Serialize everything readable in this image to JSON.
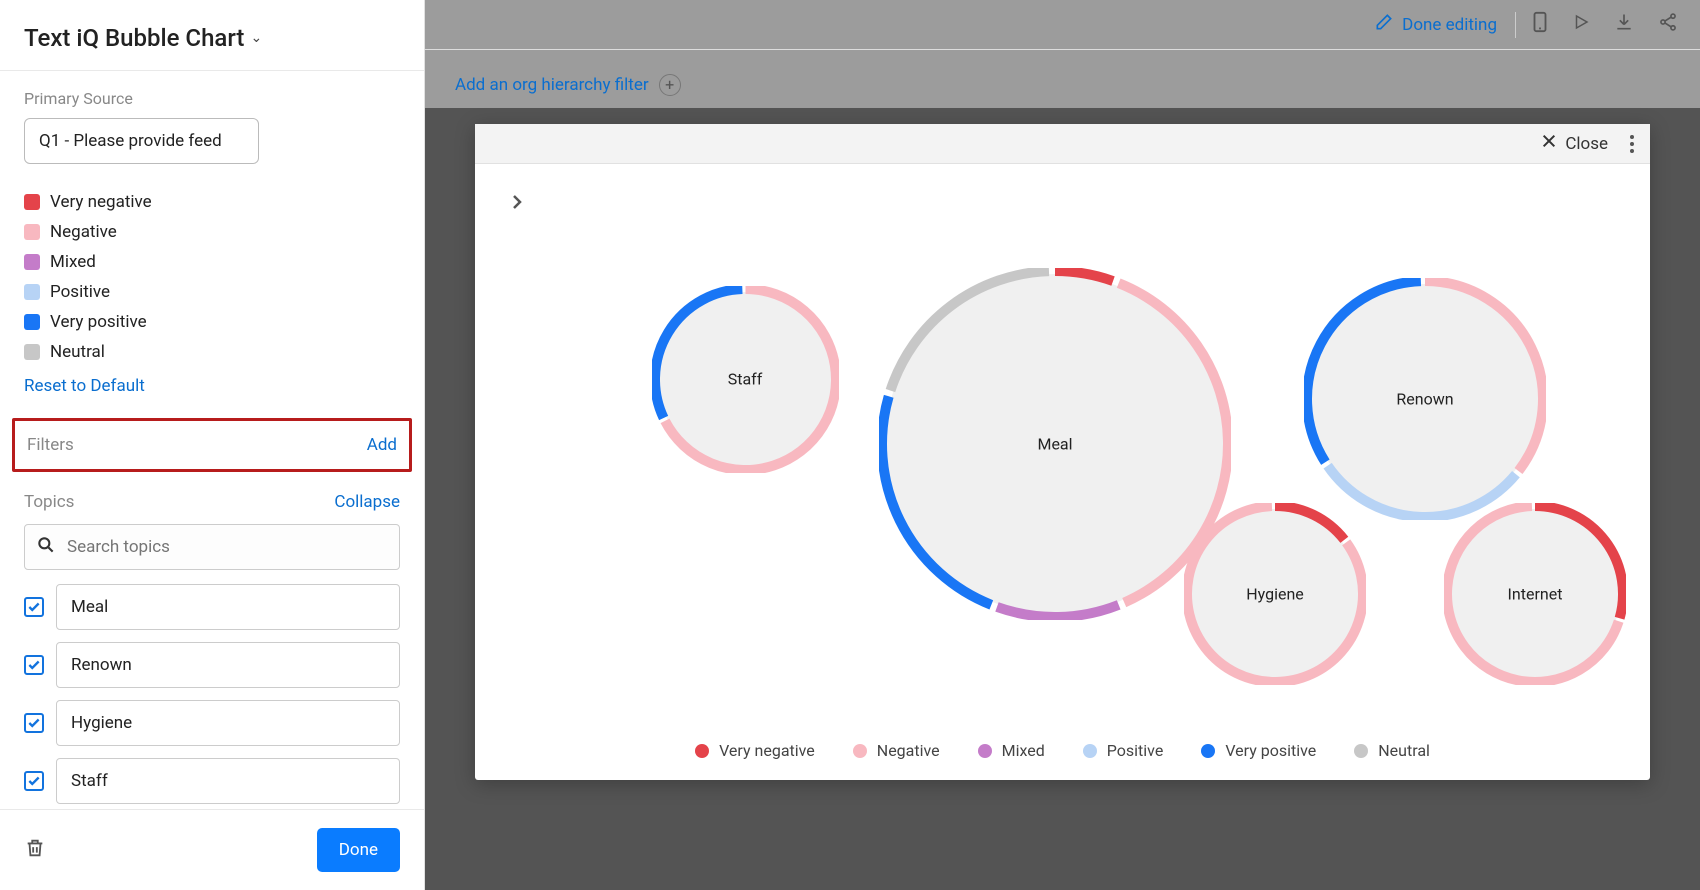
{
  "title": "Text iQ Bubble Chart",
  "primary_source": {
    "label": "Primary Source",
    "value": "Q1 - Please provide feed"
  },
  "sentiment_legend": [
    {
      "label": "Very negative",
      "color": "#e4434a"
    },
    {
      "label": "Negative",
      "color": "#f8b8c0"
    },
    {
      "label": "Mixed",
      "color": "#c47cc9"
    },
    {
      "label": "Positive",
      "color": "#b7d3f5"
    },
    {
      "label": "Very positive",
      "color": "#1976f5"
    },
    {
      "label": "Neutral",
      "color": "#c7c7c7"
    }
  ],
  "reset_label": "Reset to Default",
  "filters": {
    "label": "Filters",
    "add_label": "Add"
  },
  "topics_section": {
    "label": "Topics",
    "collapse_label": "Collapse",
    "search_placeholder": "Search topics",
    "items": [
      "Meal",
      "Renown",
      "Hygiene",
      "Staff",
      "Internet"
    ]
  },
  "footer": {
    "done_label": "Done"
  },
  "topbar": {
    "done_editing": "Done editing"
  },
  "hierarchy": {
    "label": "Add an org hierarchy filter"
  },
  "panel": {
    "close_label": "Close"
  },
  "chart_data": {
    "type": "bubble",
    "title": "",
    "legend": [
      "Very negative",
      "Negative",
      "Mixed",
      "Positive",
      "Very positive",
      "Neutral"
    ],
    "colors": {
      "Very negative": "#e4434a",
      "Negative": "#f8b8c0",
      "Mixed": "#c47cc9",
      "Positive": "#b7d3f5",
      "Very positive": "#1976f5",
      "Neutral": "#c7c7c7"
    },
    "bubbles": [
      {
        "name": "Meal",
        "size": 340,
        "segments": [
          {
            "sentiment": "Very negative",
            "pct": 6
          },
          {
            "sentiment": "Negative",
            "pct": 38
          },
          {
            "sentiment": "Mixed",
            "pct": 12
          },
          {
            "sentiment": "Very positive",
            "pct": 24
          },
          {
            "sentiment": "Neutral",
            "pct": 20
          }
        ]
      },
      {
        "name": "Renown",
        "size": 230,
        "segments": [
          {
            "sentiment": "Negative",
            "pct": 36
          },
          {
            "sentiment": "Positive",
            "pct": 30
          },
          {
            "sentiment": "Very positive",
            "pct": 34
          }
        ]
      },
      {
        "name": "Staff",
        "size": 175,
        "segments": [
          {
            "sentiment": "Negative",
            "pct": 68
          },
          {
            "sentiment": "Very positive",
            "pct": 32
          }
        ]
      },
      {
        "name": "Hygiene",
        "size": 170,
        "segments": [
          {
            "sentiment": "Very negative",
            "pct": 15
          },
          {
            "sentiment": "Negative",
            "pct": 85
          }
        ]
      },
      {
        "name": "Internet",
        "size": 170,
        "segments": [
          {
            "sentiment": "Very negative",
            "pct": 30
          },
          {
            "sentiment": "Negative",
            "pct": 70
          }
        ]
      }
    ]
  }
}
